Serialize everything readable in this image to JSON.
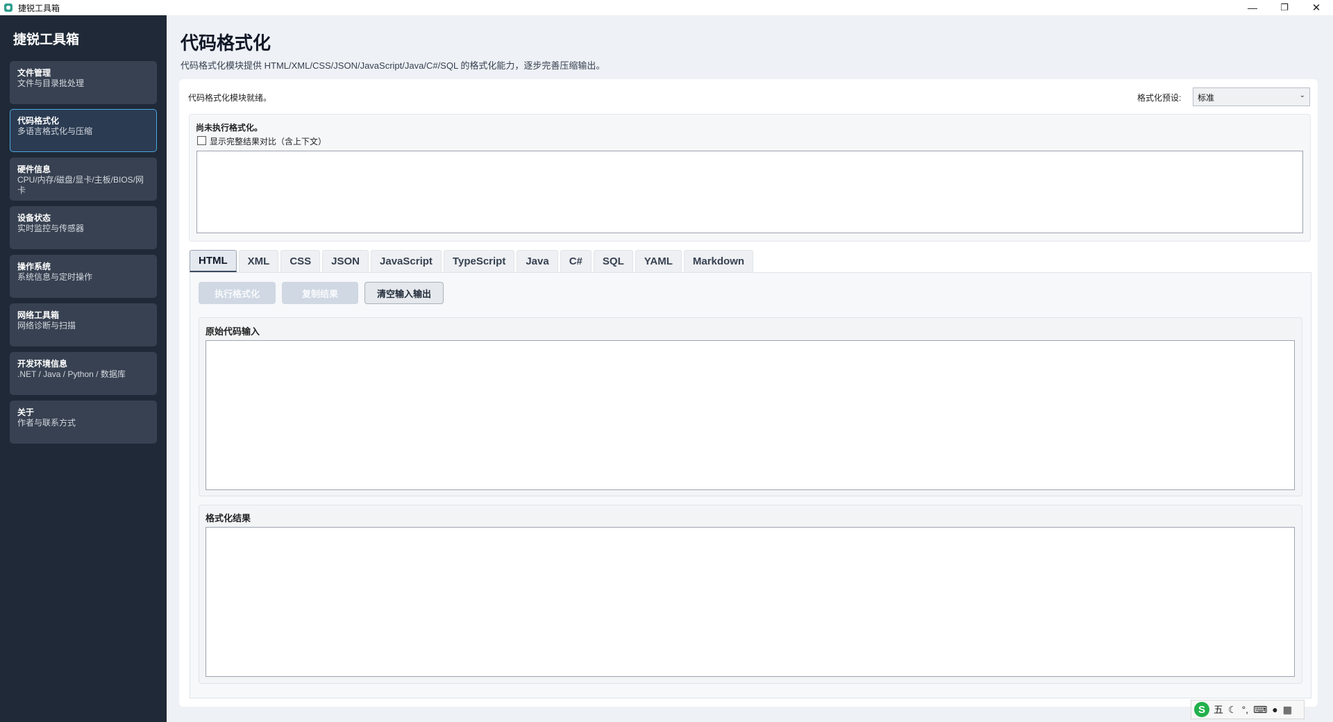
{
  "window": {
    "title": "捷锐工具箱",
    "min_icon": "—",
    "max_icon": "❐",
    "close_icon": "✕"
  },
  "sidebar": {
    "brand": "捷锐工具箱",
    "items": [
      {
        "title": "文件管理",
        "subtitle": "文件与目录批处理"
      },
      {
        "title": "代码格式化",
        "subtitle": "多语言格式化与压缩"
      },
      {
        "title": "硬件信息",
        "subtitle": "CPU/内存/磁盘/显卡/主板/BIOS/网卡"
      },
      {
        "title": "设备状态",
        "subtitle": "实时监控与传感器"
      },
      {
        "title": "操作系统",
        "subtitle": "系统信息与定时操作"
      },
      {
        "title": "网络工具箱",
        "subtitle": "网络诊断与扫描"
      },
      {
        "title": "开发环境信息",
        "subtitle": ".NET / Java / Python / 数据库"
      },
      {
        "title": "关于",
        "subtitle": "作者与联系方式"
      }
    ]
  },
  "main": {
    "title": "代码格式化",
    "description": "代码格式化模块提供 HTML/XML/CSS/JSON/JavaScript/Java/C#/SQL 的格式化能力，逐步完善压缩输出。",
    "status": "代码格式化模块就绪。",
    "preset_label": "格式化预设:",
    "preset_value": "标准",
    "compare": {
      "status": "尚未执行格式化。",
      "checkbox_label": "显示完整结果对比（含上下文）",
      "checked": false
    },
    "tabs": [
      "HTML",
      "XML",
      "CSS",
      "JSON",
      "JavaScript",
      "TypeScript",
      "Java",
      "C#",
      "SQL",
      "YAML",
      "Markdown"
    ],
    "active_tab": "HTML",
    "buttons": {
      "run": "执行格式化",
      "copy": "复制结果",
      "clear": "清空输入输出"
    },
    "input_label": "原始代码输入",
    "input_value": "",
    "output_label": "格式化结果",
    "output_value": ""
  },
  "ime": {
    "mode": "五",
    "icons": [
      "sogou-logo-icon",
      "moon-icon",
      "punctuation-icon",
      "keyboard-icon",
      "user-icon",
      "grid-icon"
    ]
  }
}
